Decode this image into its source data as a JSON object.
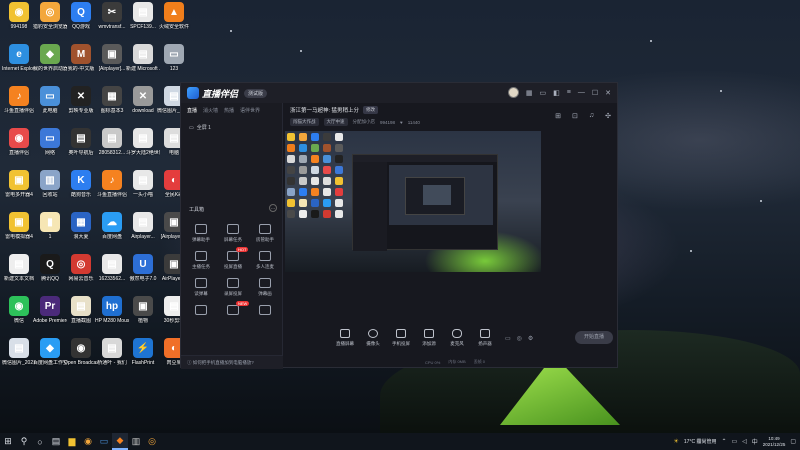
{
  "desktop": {
    "icons": [
      {
        "label": "994198",
        "color": "#f1c232",
        "glyph": "◉"
      },
      {
        "label": "猎豹安全浏览器",
        "color": "#f3a73c",
        "glyph": "◎"
      },
      {
        "label": "QQ游戏",
        "color": "#2d7ef0",
        "glyph": "Q"
      },
      {
        "label": "wmvtransf...",
        "color": "#3b3b3b",
        "glyph": "✂"
      },
      {
        "label": "SPCF139...",
        "color": "#e8e8e8",
        "glyph": "▤"
      },
      {
        "label": "火绒安全软件",
        "color": "#f07e1b",
        "glyph": "▲"
      },
      {
        "label": "Internet Explorer",
        "color": "#2d8fe0",
        "glyph": "e"
      },
      {
        "label": "我的世界启动器",
        "color": "#6aa84f",
        "glyph": "◆"
      },
      {
        "label": "我的-中文版",
        "color": "#a0522d",
        "glyph": "M"
      },
      {
        "label": "[Airplayer]...",
        "color": "#5a5a5a",
        "glyph": "▣"
      },
      {
        "label": "新建 Microsoft ...",
        "color": "#d9d9d9",
        "glyph": "▤"
      },
      {
        "label": "123",
        "color": "#9fa8b3",
        "glyph": "▭"
      },
      {
        "label": "斗鱼直播伴侣",
        "color": "#f58220",
        "glyph": "♪"
      },
      {
        "label": "此电脑",
        "color": "#4a90d9",
        "glyph": "▭"
      },
      {
        "label": "剪映专业版",
        "color": "#222222",
        "glyph": "✕"
      },
      {
        "label": "图标基本3",
        "color": "#444444",
        "glyph": "▦"
      },
      {
        "label": "download",
        "color": "#9a9a9a",
        "glyph": "✕"
      },
      {
        "label": "微信图片_20211...",
        "color": "#cfd8e3",
        "glyph": "▤"
      },
      {
        "label": "直播伴侣",
        "color": "#e84a4a",
        "glyph": "◉"
      },
      {
        "label": "网络",
        "color": "#3c78d8",
        "glyph": "▭"
      },
      {
        "label": "奥叶导航后",
        "color": "#333333",
        "glyph": "▤"
      },
      {
        "label": "28058312...",
        "color": "#c9c9c9",
        "glyph": "▤"
      },
      {
        "label": "斗罗大陆2绝世唐门",
        "color": "#e6e6e6",
        "glyph": "▤"
      },
      {
        "label": "电脑",
        "color": "#dddddd",
        "glyph": "▤"
      },
      {
        "label": "雷电多开器4",
        "color": "#f1c232",
        "glyph": "▣"
      },
      {
        "label": "回收站",
        "color": "#8aa4c8",
        "glyph": "▥"
      },
      {
        "label": "酷狗音乐",
        "color": "#2d7ef0",
        "glyph": "K"
      },
      {
        "label": "斗鱼直播伴侣",
        "color": "#f58220",
        "glyph": "♪"
      },
      {
        "label": "一头小喵",
        "color": "#e8e8e8",
        "glyph": "▤"
      },
      {
        "label": "全民K歌",
        "color": "#e43d3d",
        "glyph": "◐"
      },
      {
        "label": "雷电模拟器4",
        "color": "#f1c232",
        "glyph": "▣"
      },
      {
        "label": "1",
        "color": "#f6e6b4",
        "glyph": "▮"
      },
      {
        "label": "浪大夏",
        "color": "#2a64c4",
        "glyph": "▦"
      },
      {
        "label": "百度网盘",
        "color": "#2a9df4",
        "glyph": "☁"
      },
      {
        "label": "Airplayer...",
        "color": "#e8e8e8",
        "glyph": "▤"
      },
      {
        "label": "[Airplayer]...",
        "color": "#4a4a4a",
        "glyph": "▣"
      },
      {
        "label": "新建文本文档",
        "color": "#eeeeee",
        "glyph": "▤"
      },
      {
        "label": "腾讯QQ",
        "color": "#1a1a1a",
        "glyph": "Q"
      },
      {
        "label": "网易云音乐",
        "color": "#d33a31",
        "glyph": "◎"
      },
      {
        "label": "16233562...",
        "color": "#e8e8e8",
        "glyph": "▤"
      },
      {
        "label": "傲然电子7.0",
        "color": "#2d6fd6",
        "glyph": "U"
      },
      {
        "label": "AirPlayer...",
        "color": "#3b3b3b",
        "glyph": "▣"
      },
      {
        "label": "微信",
        "color": "#2dc15a",
        "glyph": "◉"
      },
      {
        "label": "Adobe Premiere ...",
        "color": "#4b2a7a",
        "glyph": "Pr"
      },
      {
        "label": "直播截图",
        "color": "#e8e0c8",
        "glyph": "▤"
      },
      {
        "label": "HP M280 Mouse ...",
        "color": "#1f6fd1",
        "glyph": "hp"
      },
      {
        "label": "植物",
        "color": "#4a4a4a",
        "glyph": "▣"
      },
      {
        "label": "30秒剪辑",
        "color": "#eeeeee",
        "glyph": "▤"
      },
      {
        "label": "微信图片_2021091...",
        "color": "#d8dfe8",
        "glyph": "▤"
      },
      {
        "label": "百度网盘工作空间",
        "color": "#2a9df4",
        "glyph": "◆"
      },
      {
        "label": "Open Broadcast...",
        "color": "#333333",
        "glyph": "◉"
      },
      {
        "label": "桥通叶 - 我们",
        "color": "#d8d8d8",
        "glyph": "▤"
      },
      {
        "label": "FlashPrint",
        "color": "#1e74d2",
        "glyph": "⚡"
      },
      {
        "label": "肉豆果",
        "color": "#f06f28",
        "glyph": "◐"
      }
    ]
  },
  "app": {
    "name": "直播伴侣",
    "version_badge": "测试版",
    "titlebar_icons": [
      "avatar",
      "grid-icon",
      "message-icon",
      "skin-icon",
      "menu-icon",
      "minimize-icon",
      "maximize-icon",
      "close-icon"
    ],
    "sidebar": {
      "tabs": [
        "直播",
        "消火墙",
        "热播",
        "语伴世界"
      ],
      "scene_label": "全屏 1",
      "toolbox_title": "工具箱",
      "tools": [
        {
          "label": "弹幕助手",
          "hot": ""
        },
        {
          "label": "屏幕任务",
          "hot": ""
        },
        {
          "label": "房管助手",
          "hot": ""
        },
        {
          "label": "主播任务",
          "hot": ""
        },
        {
          "label": "投屏直播",
          "hot": "HOT"
        },
        {
          "label": "多人连麦",
          "hot": ""
        },
        {
          "label": "读弹幕",
          "hot": ""
        },
        {
          "label": "录屏投屏",
          "hot": ""
        },
        {
          "label": "弹幕画",
          "hot": ""
        },
        {
          "label": "",
          "hot": ""
        },
        {
          "label": "",
          "hot": "NEW"
        },
        {
          "label": "",
          "hot": ""
        }
      ],
      "bottom_text": "如何把手机直播加到电脑播放?"
    },
    "room": {
      "title": "浙江第一马超神: 猛男稍上分",
      "edit_label": "修改",
      "meta_tags": [
        "闯猫大作战",
        "大厅中速"
      ],
      "meta_text": "分配加小店",
      "room_id": "994198",
      "fans": "11440"
    },
    "actions": [
      {
        "label": "直播屏幕"
      },
      {
        "label": "摄像头"
      },
      {
        "label": "手机投屏"
      },
      {
        "label": "添加源"
      },
      {
        "label": "麦克风"
      },
      {
        "label": "扬声器"
      }
    ],
    "go_live_label": "开始直播",
    "status": [
      "CPU 0%",
      "内存 0MB",
      "丢帧 0"
    ]
  },
  "taskbar": {
    "weather": "17°C  霾尚管用",
    "time": "10:49",
    "date": "2021/12/25"
  }
}
